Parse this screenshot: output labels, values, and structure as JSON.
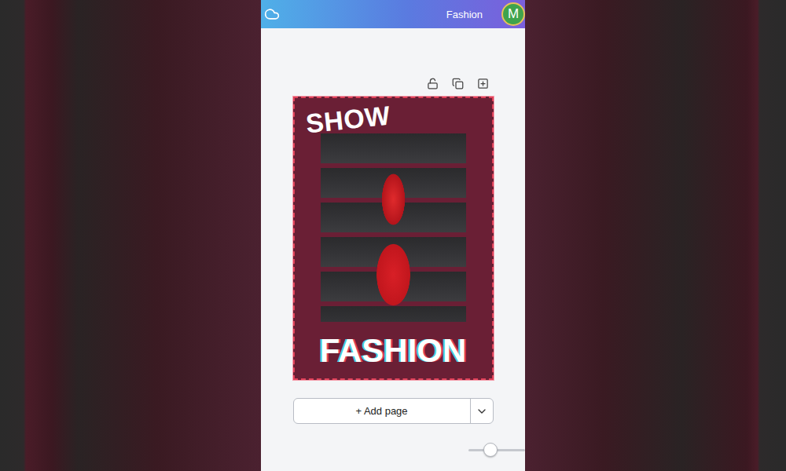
{
  "header": {
    "title": "Fashion",
    "avatar": "M"
  },
  "poster": {
    "top_text": "SHOW",
    "bottom_text": "FASHION",
    "selected": true
  },
  "add_page": {
    "label": "+ Add page"
  },
  "zoom_slider": {
    "level": 0.39
  }
}
